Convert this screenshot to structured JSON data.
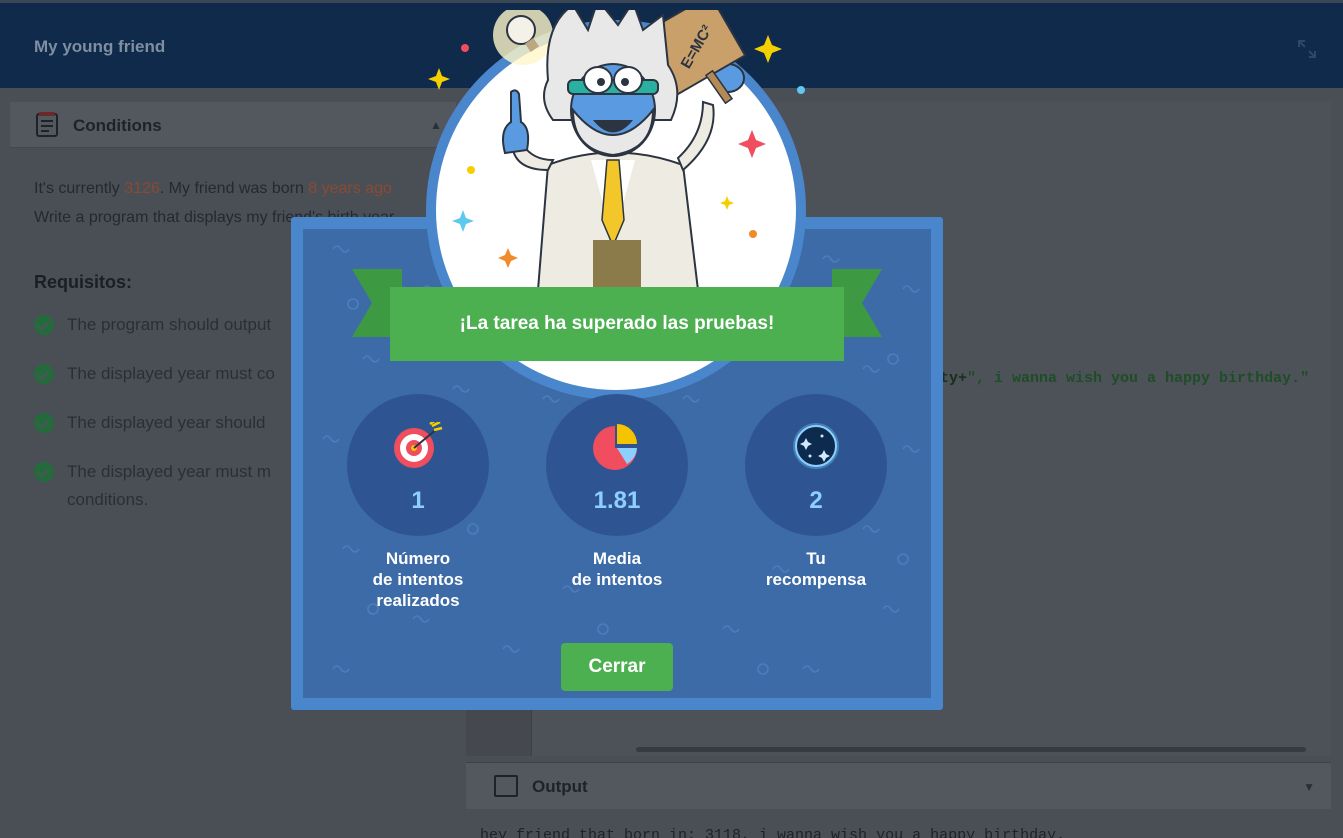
{
  "app": {
    "title": "My young friend",
    "conditions": {
      "heading": "Conditions",
      "line1_a": "It's currently ",
      "line1_year": "3126",
      "line1_b": ". My friend was born ",
      "line1_age": "8 years ago",
      "line2": "Write a program that displays my friend's birth year",
      "requirements_heading": "Requisitos:",
      "requirements": [
        "The program should output",
        "The displayed year must co",
        "The displayed year should",
        "The displayed year must m"
      ],
      "requirements_tail": "conditions."
    },
    "editor": {
      "code_prefix": "ty+",
      "code_string": "\", i wanna wish you a happy birthday.\""
    },
    "output": {
      "heading": "Output",
      "text": "hey friend that born in: 3118, i wanna wish you a happy birthday."
    }
  },
  "modal": {
    "banner": "¡La tarea ha superado las pruebas!",
    "stats": [
      {
        "icon": "target-icon",
        "value": "1",
        "caption": "Número\nde intentos\nrealizados"
      },
      {
        "icon": "pie-chart-icon",
        "value": "1.81",
        "caption": "Media\nde intentos"
      },
      {
        "icon": "dark-matter-icon",
        "value": "2",
        "caption": "Tu\nrecompensa"
      }
    ],
    "close_label": "Cerrar",
    "hero_sign": "E=MC²"
  },
  "colors": {
    "modal_border": "#4a86cc",
    "modal_bg": "#3c6ba8",
    "banner_green": "#4caf50",
    "stat_circle": "#2e5591",
    "stat_value": "#8dd0ff"
  }
}
